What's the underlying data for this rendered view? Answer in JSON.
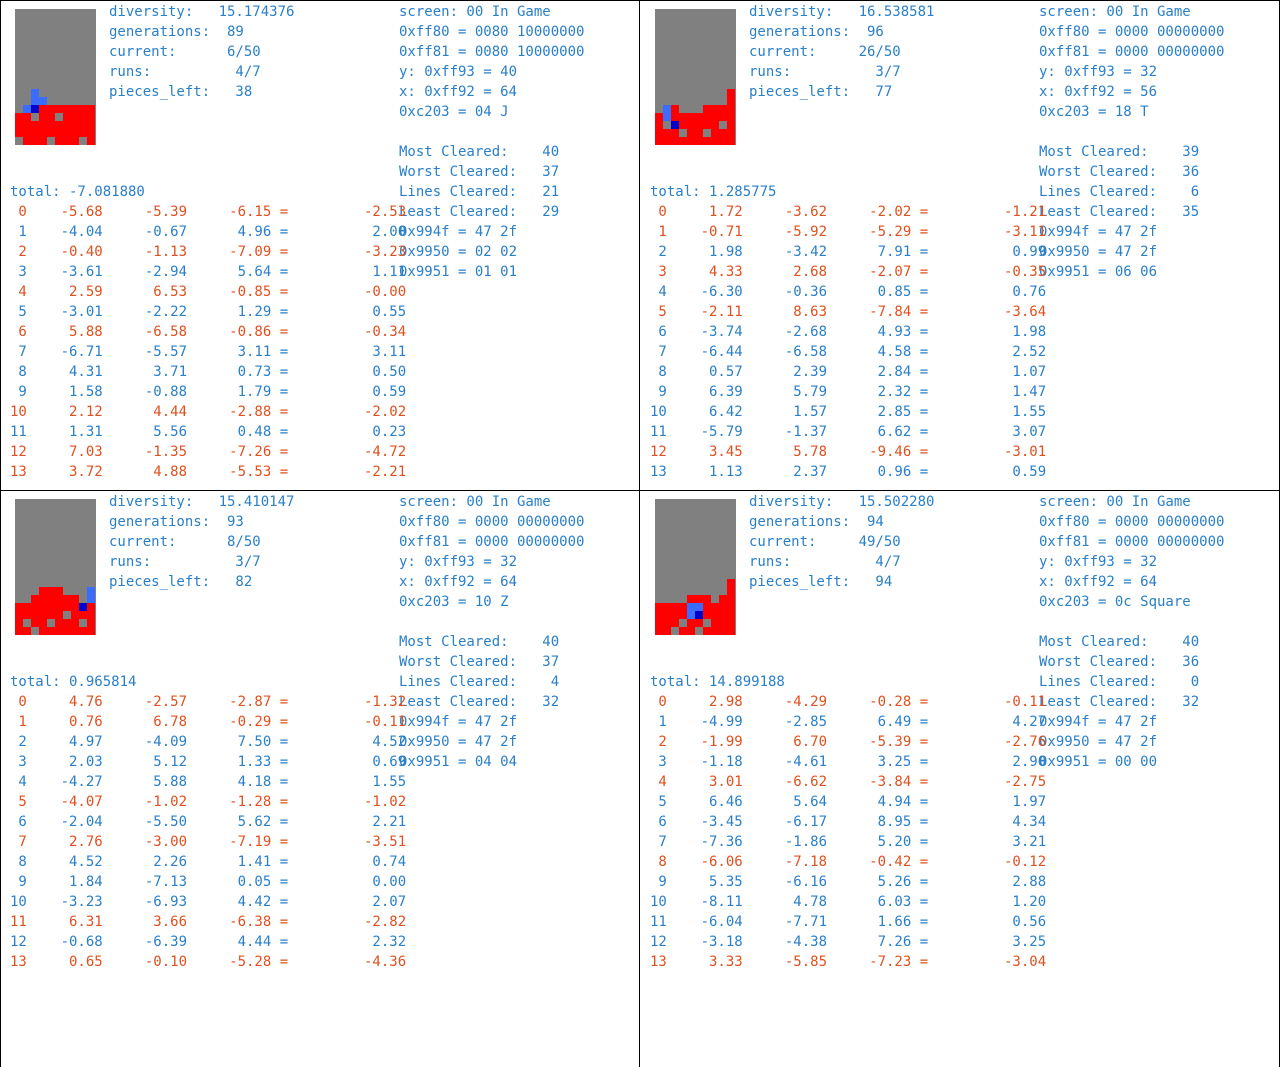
{
  "colors": {
    "positive": "#2a7fc9",
    "negative": "#e0501e",
    "board_bg": "#808080",
    "block_red": "#ff0000",
    "block_blue": "#3a6cff",
    "block_dark": "#0000cc"
  },
  "panels": [
    {
      "diversity": "15.174376",
      "generations": "89",
      "current": "6/50",
      "runs": "4/7",
      "pieces_left": "38",
      "screen": "00 In Game",
      "ff80": "0080 10000000",
      "ff81": "0080 10000000",
      "y": "0xff93 = 40",
      "x": "0xff92 = 64",
      "c203": "04 J",
      "most": "40",
      "worst": "37",
      "lines": "21",
      "least": "29",
      "a994f": "47 2f",
      "a9950": "02 02",
      "a9951": "01 01",
      "total": "-7.081880",
      "rows": [
        [
          "0",
          "-5.68",
          "-5.39",
          "-6.15",
          "-2.53"
        ],
        [
          "1",
          "-4.04",
          "-0.67",
          "4.96",
          "2.00"
        ],
        [
          "2",
          "-0.40",
          "-1.13",
          "-7.09",
          "-3.23"
        ],
        [
          "3",
          "-3.61",
          "-2.94",
          "5.64",
          "1.11"
        ],
        [
          "4",
          "2.59",
          "6.53",
          "-0.85",
          "-0.00"
        ],
        [
          "5",
          "-3.01",
          "-2.22",
          "1.29",
          "0.55"
        ],
        [
          "6",
          "5.88",
          "-6.58",
          "-0.86",
          "-0.34"
        ],
        [
          "7",
          "-6.71",
          "-5.57",
          "3.11",
          "3.11"
        ],
        [
          "8",
          "4.31",
          "3.71",
          "0.73",
          "0.50"
        ],
        [
          "9",
          "1.58",
          "-0.88",
          "1.79",
          "0.59"
        ],
        [
          "10",
          "2.12",
          "4.44",
          "-2.88",
          "-2.02"
        ],
        [
          "11",
          "1.31",
          "5.56",
          "0.48",
          "0.23"
        ],
        [
          "12",
          "7.03",
          "-1.35",
          "-7.26",
          "-4.72"
        ],
        [
          "13",
          "3.72",
          "4.88",
          "-5.53",
          "-2.21"
        ]
      ],
      "row_colors": [
        "red",
        "blue",
        "red",
        "blue",
        "red",
        "blue",
        "red",
        "blue",
        "blue",
        "blue",
        "red",
        "blue",
        "red",
        "red"
      ]
    },
    {
      "diversity": "16.538581",
      "generations": "96",
      "current": "26/50",
      "runs": "3/7",
      "pieces_left": "77",
      "screen": "00 In Game",
      "ff80": "0000 00000000",
      "ff81": "0000 00000000",
      "y": "0xff93 = 32",
      "x": "0xff92 = 56",
      "c203": "18 T",
      "most": "39",
      "worst": "36",
      "lines": "6",
      "least": "35",
      "a994f": "47 2f",
      "a9950": "47 2f",
      "a9951": "06 06",
      "total": "1.285775",
      "rows": [
        [
          "0",
          "1.72",
          "-3.62",
          "-2.02",
          "-1.21"
        ],
        [
          "1",
          "-0.71",
          "-5.92",
          "-5.29",
          "-3.11"
        ],
        [
          "2",
          "1.98",
          "-3.42",
          "7.91",
          "0.99"
        ],
        [
          "3",
          "4.33",
          "2.68",
          "-2.07",
          "-0.35"
        ],
        [
          "4",
          "-6.30",
          "-0.36",
          "0.85",
          "0.76"
        ],
        [
          "5",
          "-2.11",
          "8.63",
          "-7.84",
          "-3.64"
        ],
        [
          "6",
          "-3.74",
          "-2.68",
          "4.93",
          "1.98"
        ],
        [
          "7",
          "-6.44",
          "-6.58",
          "4.58",
          "2.52"
        ],
        [
          "8",
          "0.57",
          "2.39",
          "2.84",
          "1.07"
        ],
        [
          "9",
          "6.39",
          "5.79",
          "2.32",
          "1.47"
        ],
        [
          "10",
          "6.42",
          "1.57",
          "2.85",
          "1.55"
        ],
        [
          "11",
          "-5.79",
          "-1.37",
          "6.62",
          "3.07"
        ],
        [
          "12",
          "3.45",
          "5.78",
          "-9.46",
          "-3.01"
        ],
        [
          "13",
          "1.13",
          "2.37",
          "0.96",
          "0.59"
        ]
      ],
      "row_colors": [
        "red",
        "red",
        "blue",
        "red",
        "blue",
        "red",
        "blue",
        "blue",
        "blue",
        "blue",
        "blue",
        "blue",
        "red",
        "blue"
      ]
    },
    {
      "diversity": "15.410147",
      "generations": "93",
      "current": "8/50",
      "runs": "3/7",
      "pieces_left": "82",
      "screen": "00 In Game",
      "ff80": "0000 00000000",
      "ff81": "0000 00000000",
      "y": "0xff93 = 32",
      "x": "0xff92 = 64",
      "c203": "10 Z",
      "most": "40",
      "worst": "37",
      "lines": "4",
      "least": "32",
      "a994f": "47 2f",
      "a9950": "47 2f",
      "a9951": "04 04",
      "total": "0.965814",
      "rows": [
        [
          "0",
          "4.76",
          "-2.57",
          "-2.87",
          "-1.32"
        ],
        [
          "1",
          "0.76",
          "6.78",
          "-0.29",
          "-0.11"
        ],
        [
          "2",
          "4.97",
          "-4.09",
          "7.50",
          "4.52"
        ],
        [
          "3",
          "2.03",
          "5.12",
          "1.33",
          "0.69"
        ],
        [
          "4",
          "-4.27",
          "5.88",
          "4.18",
          "1.55"
        ],
        [
          "5",
          "-4.07",
          "-1.02",
          "-1.28",
          "-1.02"
        ],
        [
          "6",
          "-2.04",
          "-5.50",
          "5.62",
          "2.21"
        ],
        [
          "7",
          "2.76",
          "-3.00",
          "-7.19",
          "-3.51"
        ],
        [
          "8",
          "4.52",
          "2.26",
          "1.41",
          "0.74"
        ],
        [
          "9",
          "1.84",
          "-7.13",
          "0.05",
          "0.00"
        ],
        [
          "10",
          "-3.23",
          "-6.93",
          "4.42",
          "2.07"
        ],
        [
          "11",
          "6.31",
          "3.66",
          "-6.38",
          "-2.82"
        ],
        [
          "12",
          "-0.68",
          "-6.39",
          "4.44",
          "2.32"
        ],
        [
          "13",
          "0.65",
          "-0.10",
          "-5.28",
          "-4.36"
        ]
      ],
      "row_colors": [
        "red",
        "red",
        "blue",
        "blue",
        "blue",
        "red",
        "blue",
        "red",
        "blue",
        "blue",
        "blue",
        "red",
        "blue",
        "red"
      ]
    },
    {
      "diversity": "15.502280",
      "generations": "94",
      "current": "49/50",
      "runs": "4/7",
      "pieces_left": "94",
      "screen": "00 In Game",
      "ff80": "0000 00000000",
      "ff81": "0000 00000000",
      "y": "0xff93 = 32",
      "x": "0xff92 = 64",
      "c203": "0c Square",
      "most": "40",
      "worst": "36",
      "lines": "0",
      "least": "32",
      "a994f": "47 2f",
      "a9950": "47 2f",
      "a9951": "00 00",
      "total": "14.899188",
      "rows": [
        [
          "0",
          "2.98",
          "-4.29",
          "-0.28",
          "-0.11"
        ],
        [
          "1",
          "-4.99",
          "-2.85",
          "6.49",
          "4.27"
        ],
        [
          "2",
          "-1.99",
          "6.70",
          "-5.39",
          "-2.76"
        ],
        [
          "3",
          "-1.18",
          "-4.61",
          "3.25",
          "2.90"
        ],
        [
          "4",
          "3.01",
          "-6.62",
          "-3.84",
          "-2.75"
        ],
        [
          "5",
          "6.46",
          "5.64",
          "4.94",
          "1.97"
        ],
        [
          "6",
          "-3.45",
          "-6.17",
          "8.95",
          "4.34"
        ],
        [
          "7",
          "-7.36",
          "-1.86",
          "5.20",
          "3.21"
        ],
        [
          "8",
          "-6.06",
          "-7.18",
          "-0.42",
          "-0.12"
        ],
        [
          "9",
          "5.35",
          "-6.16",
          "5.26",
          "2.88"
        ],
        [
          "10",
          "-8.11",
          "4.78",
          "6.03",
          "1.20"
        ],
        [
          "11",
          "-6.04",
          "-7.71",
          "1.66",
          "0.56"
        ],
        [
          "12",
          "-3.18",
          "-4.38",
          "7.26",
          "3.25"
        ],
        [
          "13",
          "3.33",
          "-5.85",
          "-7.23",
          "-3.04"
        ]
      ],
      "row_colors": [
        "red",
        "blue",
        "red",
        "blue",
        "red",
        "blue",
        "blue",
        "blue",
        "red",
        "blue",
        "blue",
        "blue",
        "blue",
        "red"
      ]
    }
  ]
}
